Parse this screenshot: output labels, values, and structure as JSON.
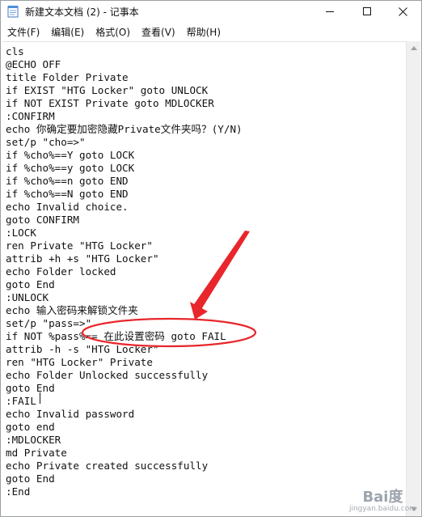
{
  "window": {
    "title": "新建文本文档 (2) - 记事本",
    "controls": {
      "minimize": "minimize-icon",
      "maximize": "maximize-icon",
      "close": "close-icon"
    }
  },
  "menubar": {
    "items": [
      "文件(F)",
      "编辑(E)",
      "格式(O)",
      "查看(V)",
      "帮助(H)"
    ]
  },
  "editor": {
    "lines": [
      "cls",
      "@ECHO OFF",
      "title Folder Private",
      "if EXIST \"HTG Locker\" goto UNLOCK",
      "if NOT EXIST Private goto MDLOCKER",
      ":CONFIRM",
      "echo 你确定要加密隐藏Private文件夹吗？(Y/N)",
      "set/p \"cho=>\"",
      "if %cho%==Y goto LOCK",
      "if %cho%==y goto LOCK",
      "if %cho%==n goto END",
      "if %cho%==N goto END",
      "echo Invalid choice.",
      "goto CONFIRM",
      ":LOCK",
      "ren Private \"HTG Locker\"",
      "attrib +h +s \"HTG Locker\"",
      "echo Folder locked",
      "goto End",
      ":UNLOCK",
      "echo 输入密码来解锁文件夹",
      "set/p \"pass=>\"",
      "if NOT %pass%== 在此设置密码 goto FAIL",
      "attrib -h -s \"HTG Locker\"",
      "ren \"HTG Locker\" Private",
      "echo Folder Unlocked successfully",
      "goto End",
      ":FAIL",
      "echo Invalid password",
      "goto end",
      ":MDLOCKER",
      "md Private",
      "echo Private created successfully",
      "goto End",
      ":End"
    ]
  },
  "annotation": {
    "color": "#e8262b"
  },
  "watermark": {
    "logo": "Bai度",
    "sub": "jingyan.baidu.com"
  },
  "colors": {
    "text": "#111111",
    "background": "#ffffff",
    "scrollbar": "#f0f0f0"
  }
}
